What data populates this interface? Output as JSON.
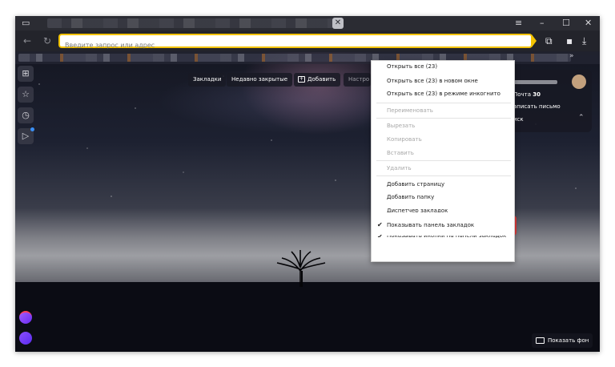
{
  "address_bar": {
    "placeholder": "Введите запрос или адрес"
  },
  "quick_toolbar": {
    "bookmarks": "Закладки",
    "recently_closed": "Недавно закрытые",
    "add": "Добавить",
    "settings_partial": "Настро"
  },
  "mail_widget": {
    "mail_label": "Почта",
    "mail_count": "30",
    "write_letter": "аписать письмо",
    "disk": "иск"
  },
  "context_menu": {
    "items": [
      {
        "label": "Открыть все (23)",
        "enabled": true
      },
      {
        "label": "Открыть все (23) в новом окне",
        "enabled": true
      },
      {
        "label": "Открыть все (23) в режиме инкогнито",
        "enabled": true
      },
      {
        "label": "Переименовать",
        "enabled": false
      },
      {
        "label": "Вырезать",
        "enabled": false
      },
      {
        "label": "Копировать",
        "enabled": false
      },
      {
        "label": "Вставить",
        "enabled": false
      },
      {
        "label": "Удалить",
        "enabled": false
      },
      {
        "label": "Добавить страницу",
        "enabled": true
      },
      {
        "label": "Добавить папку",
        "enabled": true
      },
      {
        "label": "Диспетчер закладок",
        "enabled": true
      },
      {
        "label": "Показывать панель закладок",
        "enabled": true,
        "checked": true
      },
      {
        "label": "Показывать иконки на панели закладок",
        "enabled": true,
        "checked": true
      }
    ]
  },
  "show_background_button": "Показать фон",
  "colors": {
    "accent": "#f2c200",
    "highlight": "#e33a3a",
    "alice": "#7a3ff5"
  }
}
